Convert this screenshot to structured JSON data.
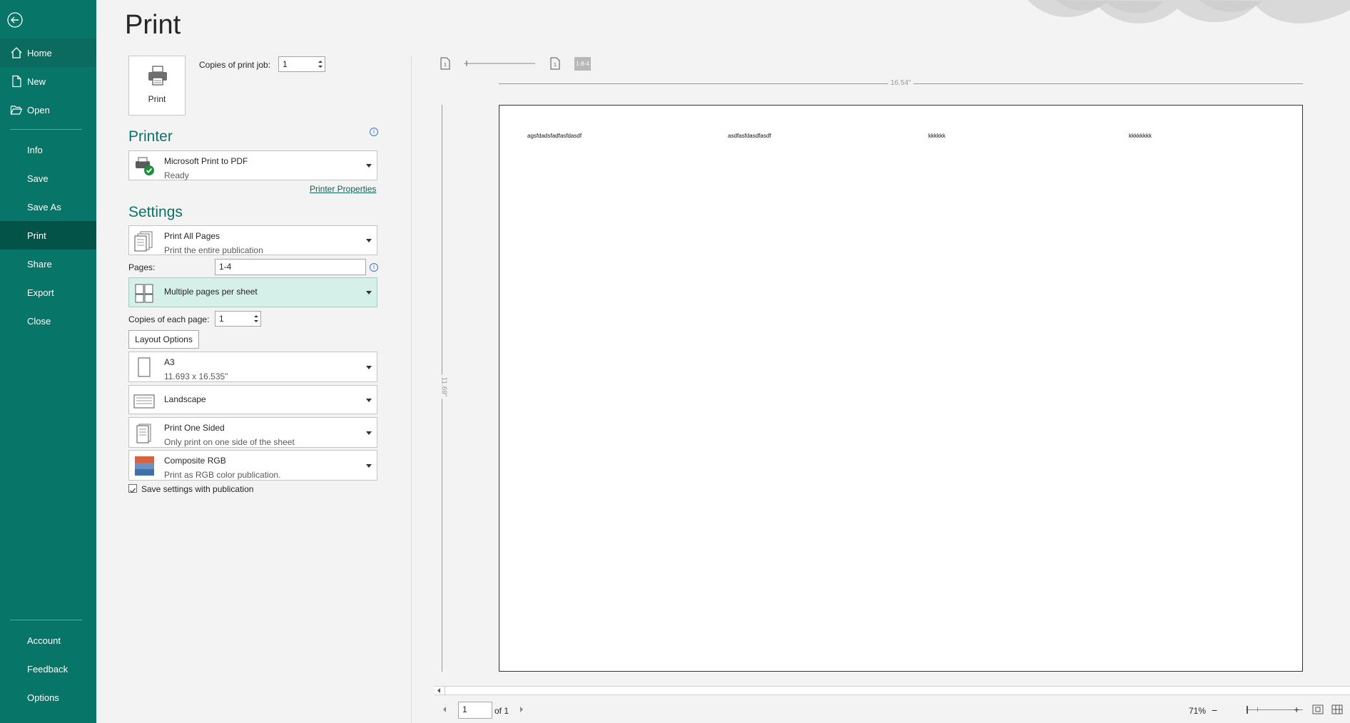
{
  "nav": {
    "back_icon": "back-arrow-icon",
    "items_top": [
      {
        "label": "Home",
        "icon": "home-icon"
      },
      {
        "label": "New",
        "icon": "new-document-icon"
      },
      {
        "label": "Open",
        "icon": "folder-open-icon"
      }
    ],
    "items_mid": [
      "Info",
      "Save",
      "Save As",
      "Print",
      "Share",
      "Export",
      "Close"
    ],
    "items_bottom": [
      "Account",
      "Feedback",
      "Options"
    ],
    "selected": "Print",
    "accent": "#077568",
    "selected_bg": "#035349"
  },
  "page": {
    "title": "Print"
  },
  "print_button": {
    "label": "Print",
    "icon": "printer-icon"
  },
  "copies_job": {
    "label": "Copies of print job:",
    "value": "1"
  },
  "printer": {
    "heading": "Printer",
    "name": "Microsoft Print to PDF",
    "status": "Ready",
    "properties_link": "Printer Properties"
  },
  "settings": {
    "heading": "Settings",
    "pages_mode": {
      "main": "Print All Pages",
      "sub": "Print the entire publication"
    },
    "pages_label": "Pages:",
    "pages_value": "1-4",
    "layout": {
      "main": "Multiple pages per sheet"
    },
    "copies_each_label": "Copies of each page:",
    "copies_each_value": "1",
    "layout_options": "Layout Options",
    "paper": {
      "main": "A3",
      "sub": "11.693 x 16.535\""
    },
    "orientation": {
      "main": "Landscape"
    },
    "sides": {
      "main": "Print One Sided",
      "sub": "Only print on one side of the sheet"
    },
    "color": {
      "main": "Composite RGB",
      "sub": "Print as RGB color publication."
    },
    "save_settings": {
      "label": "Save settings with publication",
      "checked": true
    },
    "highlight_color": "#d5efe9"
  },
  "preview": {
    "ruler_width": "16.54\"",
    "ruler_height": "11.69\"",
    "page_texts": [
      "agsfdadsfadfasfdasdf",
      "asdfasfdasdfasdf",
      "kkkkkk",
      "kkkkkkkk"
    ],
    "toolbar_badge": "1-8-4"
  },
  "status": {
    "page_value": "1",
    "page_of": "of 1",
    "zoom": "71%",
    "minus": "−",
    "plus": "+"
  }
}
